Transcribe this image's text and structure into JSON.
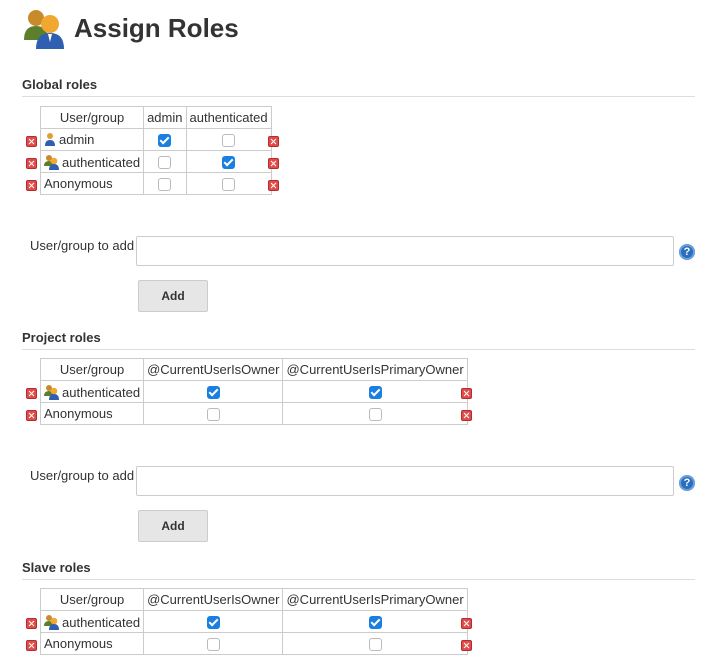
{
  "page": {
    "title": "Assign Roles"
  },
  "global": {
    "title": "Global roles",
    "headers": [
      "User/group",
      "admin",
      "authenticated"
    ],
    "rows": [
      {
        "name": "admin",
        "icon": "user-icon",
        "checks": [
          true,
          false
        ]
      },
      {
        "name": "authenticated",
        "icon": "group-icon",
        "checks": [
          false,
          true
        ]
      },
      {
        "name": "Anonymous",
        "icon": "",
        "checks": [
          false,
          false
        ]
      }
    ],
    "add_label": "User/group to add",
    "add_value": "",
    "add_button": "Add"
  },
  "project": {
    "title": "Project roles",
    "headers": [
      "User/group",
      "@CurrentUserIsOwner",
      "@CurrentUserIsPrimaryOwner"
    ],
    "rows": [
      {
        "name": "authenticated",
        "icon": "group-icon",
        "checks": [
          true,
          true
        ]
      },
      {
        "name": "Anonymous",
        "icon": "",
        "checks": [
          false,
          false
        ]
      }
    ],
    "add_label": "User/group to add",
    "add_value": "",
    "add_button": "Add"
  },
  "slave": {
    "title": "Slave roles",
    "headers": [
      "User/group",
      "@CurrentUserIsOwner",
      "@CurrentUserIsPrimaryOwner"
    ],
    "rows": [
      {
        "name": "authenticated",
        "icon": "group-icon",
        "checks": [
          true,
          true
        ]
      },
      {
        "name": "Anonymous",
        "icon": "",
        "checks": [
          false,
          false
        ]
      }
    ]
  },
  "help_glyph": "?",
  "colors": {
    "checkbox_on": "#1a7fe0",
    "delete": "#e04b4b",
    "help": "#2a6ebd"
  }
}
